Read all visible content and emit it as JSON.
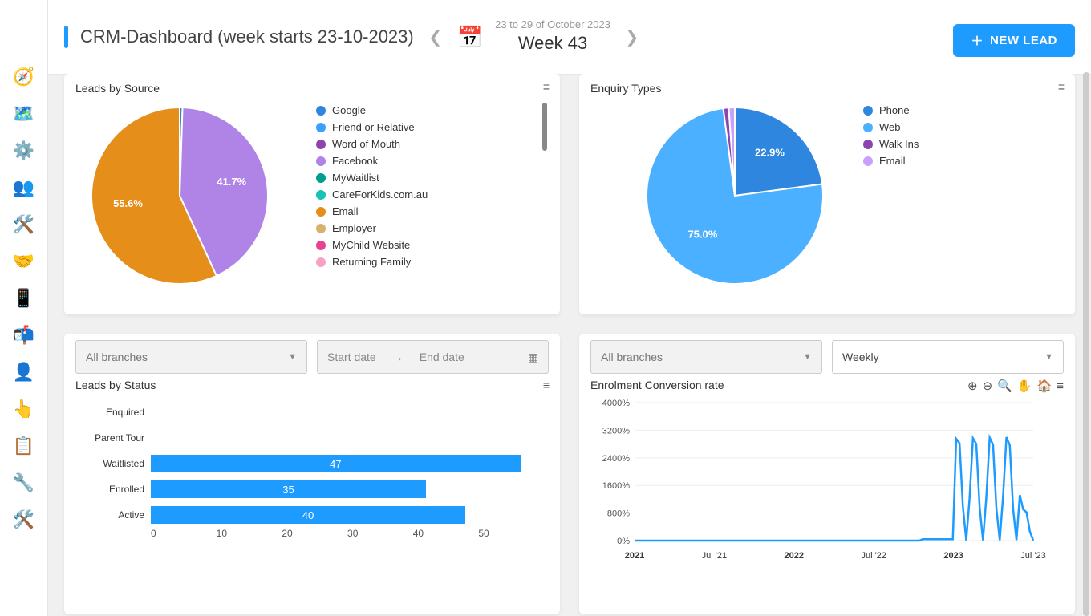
{
  "header": {
    "title": "CRM-Dashboard (week starts 23-10-2023)",
    "date_range": "23 to 29 of October 2023",
    "week_label": "Week 43",
    "new_lead": "NEW LEAD"
  },
  "sidebar_icons": [
    "dashboard",
    "map",
    "settings-gear",
    "people",
    "config-gear",
    "handshake",
    "phone-device",
    "mailbox",
    "user-gear",
    "hand-point",
    "clipboard",
    "wrench",
    "wrench-cross"
  ],
  "cards": {
    "leads_by_source": {
      "title": "Leads by Source"
    },
    "enquiry_types": {
      "title": "Enquiry Types"
    },
    "leads_by_status": {
      "title": "Leads by Status",
      "branch_placeholder": "All branches",
      "start_placeholder": "Start date",
      "end_placeholder": "End date"
    },
    "enrolment_rate": {
      "title": "Enrolment Conversion rate",
      "branch_placeholder": "All branches",
      "period_value": "Weekly"
    }
  },
  "chart_data": [
    {
      "id": "leads_by_source",
      "type": "pie",
      "title": "Leads by Source",
      "series": [
        {
          "name": "Google",
          "value": 0.5,
          "color": "#2e86de",
          "label": ""
        },
        {
          "name": "Friend or Relative",
          "value": 0,
          "color": "#3aa0ff",
          "label": ""
        },
        {
          "name": "Word of Mouth",
          "value": 0,
          "color": "#8e44ad",
          "label": ""
        },
        {
          "name": "Facebook",
          "value": 41.7,
          "color": "#b084e6",
          "label": "41.7%"
        },
        {
          "name": "MyWaitlist",
          "value": 0,
          "color": "#009e8e",
          "label": ""
        },
        {
          "name": "CareForKids.com.au",
          "value": 0,
          "color": "#17c3b2",
          "label": ""
        },
        {
          "name": "Email",
          "value": 55.6,
          "color": "#e58e1a",
          "label": "55.6%"
        },
        {
          "name": "Employer",
          "value": 0,
          "color": "#d6b26e",
          "label": ""
        },
        {
          "name": "MyChild Website",
          "value": 0,
          "color": "#e84393",
          "label": ""
        },
        {
          "name": "Returning Family",
          "value": 0,
          "color": "#f7a1c4",
          "label": ""
        }
      ]
    },
    {
      "id": "enquiry_types",
      "type": "pie",
      "title": "Enquiry Types",
      "series": [
        {
          "name": "Phone",
          "value": 22.9,
          "color": "#2e86de",
          "label": "22.9%"
        },
        {
          "name": "Web",
          "value": 75.0,
          "color": "#4ab0ff",
          "label": "75.0%"
        },
        {
          "name": "Walk Ins",
          "value": 1.0,
          "color": "#8e44ad",
          "label": ""
        },
        {
          "name": "Email",
          "value": 1.1,
          "color": "#c9a0ff",
          "label": ""
        }
      ]
    },
    {
      "id": "leads_by_status",
      "type": "bar",
      "title": "Leads by Status",
      "orientation": "horizontal",
      "xlim": [
        0,
        50
      ],
      "xticks": [
        0,
        10,
        20,
        30,
        40,
        50
      ],
      "categories": [
        "Enquired",
        "Parent Tour",
        "Waitlisted",
        "Enrolled",
        "Active"
      ],
      "values": [
        0,
        0,
        47,
        35,
        40
      ],
      "color": "#1e9bff"
    },
    {
      "id": "enrolment_rate",
      "type": "line",
      "title": "Enrolment Conversion rate",
      "ylabel": "",
      "ylim": [
        0,
        4000
      ],
      "yticks": [
        "0%",
        "800%",
        "1600%",
        "2400%",
        "3200%",
        "4000%"
      ],
      "xticks": [
        "2021",
        "Jul '21",
        "2022",
        "Jul '22",
        "2023",
        "Jul '23"
      ],
      "series": [
        {
          "name": "rate",
          "color": "#1e9bff"
        }
      ],
      "value_summary": "≈0% from 2021 through early 2023, then oscillating spikes up to ~3200% around Jul '23"
    }
  ]
}
